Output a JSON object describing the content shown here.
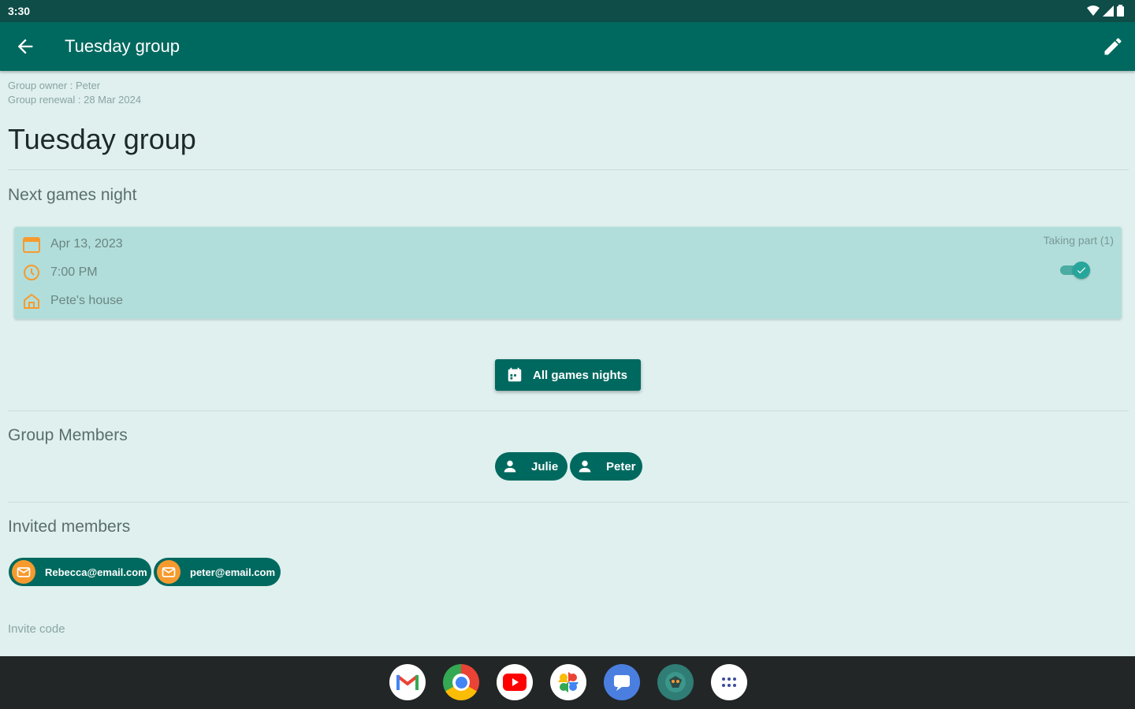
{
  "status_bar": {
    "time": "3:30"
  },
  "app_bar": {
    "title": "Tuesday group",
    "back_icon": "arrow-back-icon",
    "edit_icon": "pencil-icon"
  },
  "group": {
    "owner_line": "Group owner : Peter",
    "renewal_line": "Group renewal : 28 Mar 2024",
    "title": "Tuesday group"
  },
  "next_night": {
    "section_title": "Next games night",
    "date": "Apr 13, 2023",
    "time": "7:00 PM",
    "location": "Pete's house",
    "taking_part_label": "Taking part (1)",
    "taking_part_on": true
  },
  "all_nights_button": {
    "label": "All games nights"
  },
  "members": {
    "section_title": "Group Members",
    "items": [
      {
        "name": "Julie"
      },
      {
        "name": "Peter"
      }
    ]
  },
  "invited": {
    "section_title": "Invited members",
    "items": [
      {
        "email": "Rebecca@email.com"
      },
      {
        "email": "peter@email.com"
      }
    ]
  },
  "invite_code": {
    "label": "Invite code"
  },
  "dock": {
    "apps": [
      "gmail-icon",
      "chrome-icon",
      "youtube-icon",
      "photos-icon",
      "messages-icon",
      "board-game-app-icon",
      "app-drawer-icon"
    ]
  },
  "colors": {
    "primary": "#00695f",
    "status_bar": "#0f4d48",
    "background": "#dff0ee",
    "card": "#b1dedb",
    "accent_orange": "#f79a2e"
  }
}
